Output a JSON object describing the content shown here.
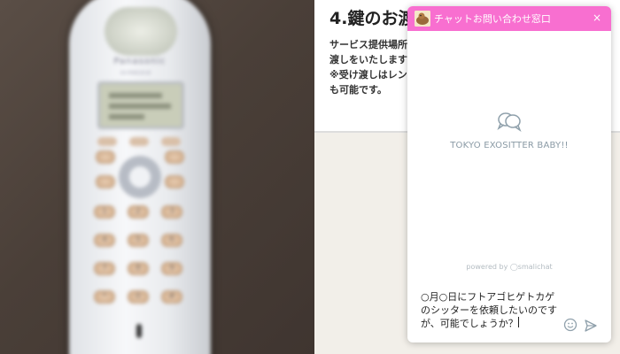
{
  "photo": {
    "brand": "Panasonic",
    "model": "KX-FKN526-W",
    "keys": [
      "1",
      "2",
      "3",
      "4",
      "5",
      "6",
      "7",
      "8",
      "9",
      "*",
      "0",
      "#"
    ]
  },
  "section": {
    "heading": "4.鍵のお渡",
    "body": "サービス提供場所\n渡しをいたします\n※受け渡しはレン\nも可能です。"
  },
  "chat": {
    "header_color": "#f86fd0",
    "title": "チャットお問い合わせ窓口",
    "close_label": "×",
    "business_name": "TOKYO EXOSITTER BABY!!",
    "powered_by": "powered by ◯smalichat",
    "composer_text": "○月○日にフトアゴヒゲトカゲ\nのシッターを依頼したいのです\nが、可能でしょうか？",
    "icons": [
      "chat-bubbles-icon",
      "emoji-icon",
      "send-icon",
      "close-icon",
      "avatar"
    ]
  }
}
